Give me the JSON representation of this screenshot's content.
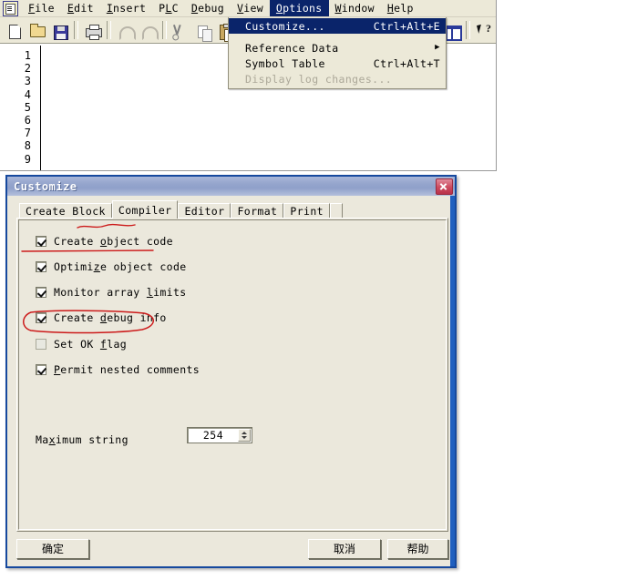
{
  "app": {
    "icon": "document-app-icon",
    "menubar": [
      {
        "label": "File",
        "mnemonic": "F"
      },
      {
        "label": "Edit",
        "mnemonic": "E"
      },
      {
        "label": "Insert",
        "mnemonic": "I"
      },
      {
        "label": "PLC",
        "mnemonic": "L"
      },
      {
        "label": "Debug",
        "mnemonic": "D"
      },
      {
        "label": "View",
        "mnemonic": "V"
      },
      {
        "label": "Options",
        "mnemonic": "O",
        "active": true
      },
      {
        "label": "Window",
        "mnemonic": "W"
      },
      {
        "label": "Help",
        "mnemonic": "H"
      }
    ],
    "toolbar": [
      {
        "name": "new-file-icon"
      },
      {
        "name": "open-file-icon"
      },
      {
        "name": "save-file-icon"
      },
      {
        "name": "print-icon"
      },
      {
        "name": "undo-icon"
      },
      {
        "name": "redo-icon"
      },
      {
        "name": "cut-icon"
      },
      {
        "name": "copy-icon"
      },
      {
        "name": "paste-icon"
      },
      {
        "name": "compile-icon"
      },
      {
        "name": "download-icon"
      },
      {
        "name": "split-window-icon"
      },
      {
        "name": "context-help-icon"
      }
    ],
    "editor": {
      "line_numbers": [
        "1",
        "2",
        "3",
        "4",
        "5",
        "6",
        "7",
        "8",
        "9"
      ]
    }
  },
  "options_menu": {
    "items": [
      {
        "label": "Customize...",
        "accel": "Ctrl+Alt+E",
        "mnemonic": "z",
        "highlighted": true,
        "disabled": false,
        "submenu": false
      },
      {
        "label": "Reference Data",
        "accel": "",
        "mnemonic": "R",
        "highlighted": false,
        "disabled": false,
        "submenu": true
      },
      {
        "label": "Symbol Table",
        "accel": "Ctrl+Alt+T",
        "mnemonic": "S",
        "highlighted": false,
        "disabled": false,
        "submenu": false
      },
      {
        "label": "Display log changes...",
        "accel": "",
        "mnemonic": "D",
        "highlighted": false,
        "disabled": true,
        "submenu": false
      }
    ],
    "submenu_arrow": "▶"
  },
  "dialog": {
    "title": "Customize",
    "close_icon": "close-icon",
    "tabs": [
      {
        "label": "Create Block",
        "selected": false
      },
      {
        "label": "Compiler",
        "selected": true
      },
      {
        "label": "Editor",
        "selected": false
      },
      {
        "label": "Format",
        "selected": false
      },
      {
        "label": "Print",
        "selected": false
      }
    ],
    "checkboxes": [
      {
        "label": "Create object code",
        "checked": true,
        "mnemonic": "o"
      },
      {
        "label": "Optimize object code",
        "checked": true,
        "mnemonic": "z"
      },
      {
        "label": "Monitor array limits",
        "checked": true,
        "mnemonic": "l"
      },
      {
        "label": "Create debug info",
        "checked": true,
        "mnemonic": "d"
      },
      {
        "label": "Set OK flag",
        "checked": false,
        "mnemonic": "f"
      },
      {
        "label": "Permit nested comments",
        "checked": true,
        "mnemonic": "P"
      }
    ],
    "maximum_string": {
      "label": "Maximum string",
      "mnemonic": "x",
      "value": "254"
    },
    "buttons": {
      "ok": "确定",
      "cancel": "取消",
      "help": "帮助"
    }
  },
  "annotations": {
    "color": "#cc1a1a",
    "marks": [
      {
        "name": "compiler-tab-underline",
        "shape": "underline",
        "target": "Compiler"
      },
      {
        "name": "create-object-underline",
        "shape": "underline",
        "target": "Create object code"
      },
      {
        "name": "create-debug-ellipse",
        "shape": "ellipse",
        "target": "Create debug info"
      }
    ]
  }
}
